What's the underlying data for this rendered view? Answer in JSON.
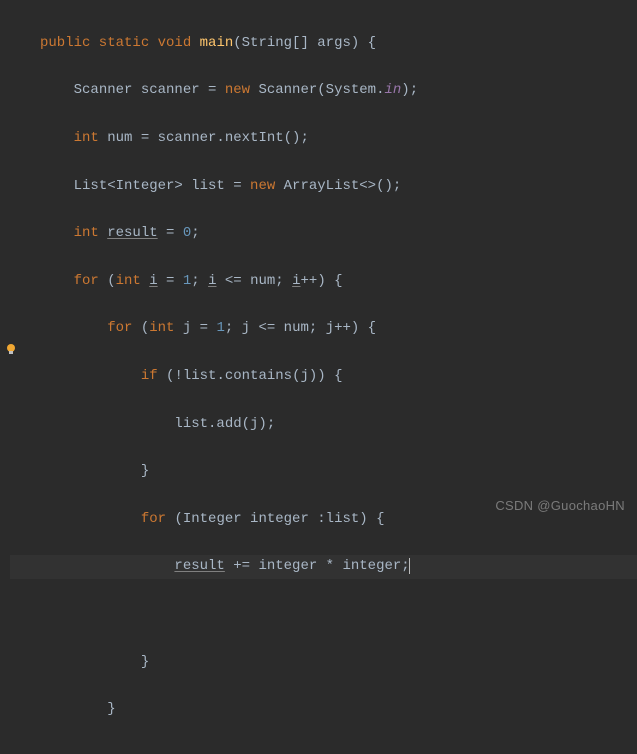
{
  "code": {
    "l1": {
      "t1": "public static void ",
      "t2": "main",
      "t3": "(String[] args) {"
    },
    "l2": {
      "t1": "Scanner scanner = ",
      "t2": "new ",
      "t3": "Scanner(System.",
      "t4": "in",
      "t5": ");"
    },
    "l3": {
      "t1": "int ",
      "t2": "num = scanner.nextInt();"
    },
    "l4": {
      "t1": "List<Integer> list = ",
      "t2": "new ",
      "t3": "ArrayList<>();"
    },
    "l5": {
      "t1": "int ",
      "t2": "result",
      "t3": " = ",
      "t4": "0",
      "t5": ";"
    },
    "l6": {
      "t1": "for ",
      "t2": "(",
      "t3": "int ",
      "t4": "i",
      "t5": " = ",
      "t6": "1",
      "t7": "; ",
      "t8": "i",
      "t9": " <= num; ",
      "t10": "i",
      "t11": "++) {"
    },
    "l7": {
      "t1": "for ",
      "t2": "(",
      "t3": "int ",
      "t4": "j = ",
      "t5": "1",
      "t6": "; j <= num; j++) {"
    },
    "l8": {
      "t1": "if ",
      "t2": "(!list.contains(j)) {"
    },
    "l9": {
      "t1": "list.add(j);"
    },
    "l10": {
      "t1": "}"
    },
    "l11": {
      "t1": "for ",
      "t2": "(Integer integer :list) {"
    },
    "l12": {
      "t1": "result",
      "t2": " += integer * integer;"
    },
    "l13": {
      "t1": ""
    },
    "l14": {
      "t1": "}"
    },
    "l15": {
      "t1": "}"
    }
  },
  "watermark": "CSDN @GuochaoHN",
  "icon": "lightbulb-icon"
}
